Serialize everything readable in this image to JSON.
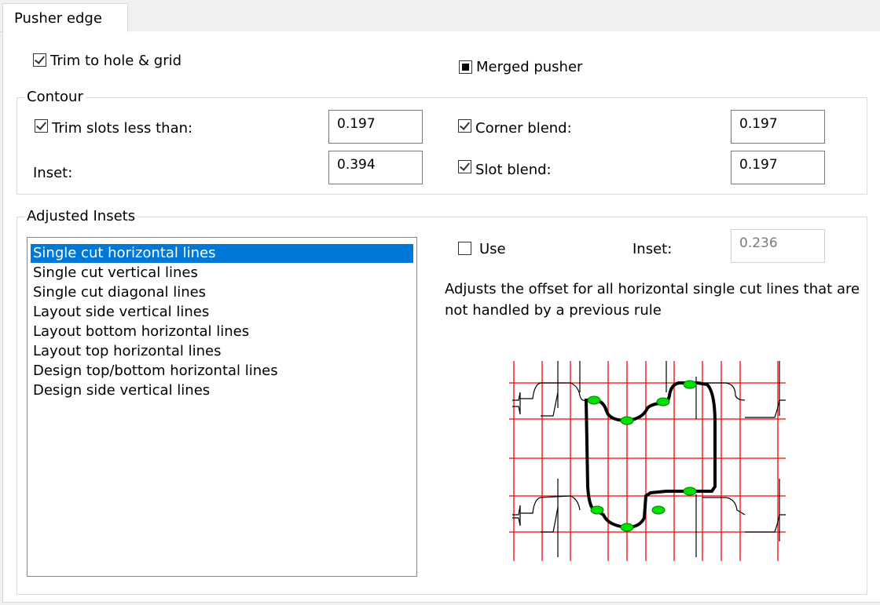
{
  "tab": {
    "label": "Pusher edge"
  },
  "options": {
    "trim_to_hole_grid": {
      "label": "Trim to hole & grid",
      "checked": true
    },
    "merged_pusher": {
      "label": "Merged pusher",
      "state": "indeterminate"
    }
  },
  "contour": {
    "title": "Contour",
    "trim_slots": {
      "label": "Trim slots less than:",
      "checked": true,
      "value": "0.197"
    },
    "inset": {
      "label": "Inset:",
      "value": "0.394"
    },
    "corner_blend": {
      "label": "Corner blend:",
      "checked": true,
      "value": "0.197"
    },
    "slot_blend": {
      "label": "Slot blend:",
      "checked": true,
      "value": "0.197"
    }
  },
  "adjusted": {
    "title": "Adjusted Insets",
    "items": [
      "Single cut horizontal lines",
      "Single cut vertical lines",
      "Single cut diagonal lines",
      "Layout side vertical lines",
      "Layout bottom horizontal lines",
      "Layout top horizontal lines",
      "Design top/bottom horizontal lines",
      "Design side vertical lines"
    ],
    "selected_index": 0,
    "use": {
      "label": "Use",
      "checked": false
    },
    "inset_label": "Inset:",
    "inset_value": "0.236",
    "description": "Adjusts the offset for all horizontal single cut lines that are not handled by a previous rule"
  },
  "colors": {
    "grid": "#ff0000",
    "marker": "#00e000",
    "selection": "#0078d7"
  }
}
